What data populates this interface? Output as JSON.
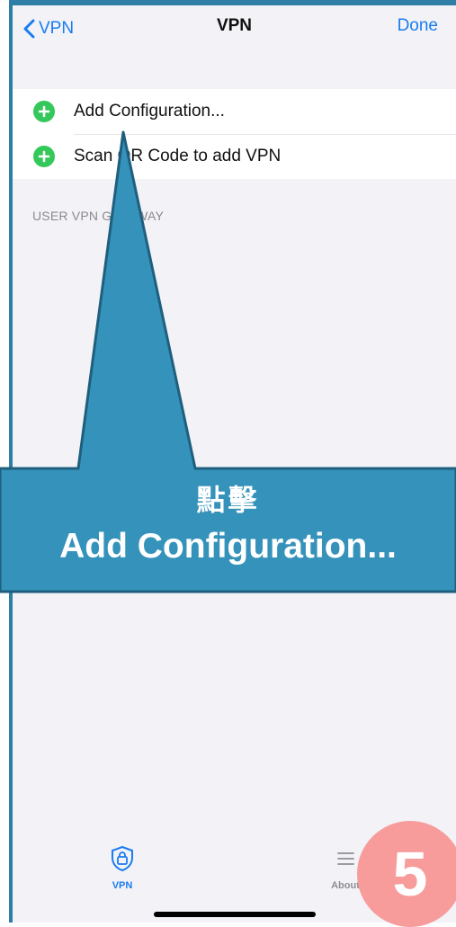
{
  "nav": {
    "back_label": "VPN",
    "title": "VPN",
    "done_label": "Done"
  },
  "list": {
    "items": [
      {
        "label": "Add Configuration..."
      },
      {
        "label": "Scan QR Code to add VPN"
      }
    ]
  },
  "section_header": "USER VPN GATEWAY",
  "callout": {
    "line1": "點擊",
    "line2": "Add Configuration..."
  },
  "tabbar": {
    "items": [
      {
        "label": "VPN",
        "icon": "shield-lock-icon",
        "selected": true
      },
      {
        "label": "About",
        "icon": "list-icon",
        "selected": false
      }
    ]
  },
  "step_badge": {
    "number": "5"
  },
  "colors": {
    "accent": "#1a7cf1",
    "add": "#34c759",
    "callout": "#3592ba",
    "badge": "#f79b9b"
  }
}
